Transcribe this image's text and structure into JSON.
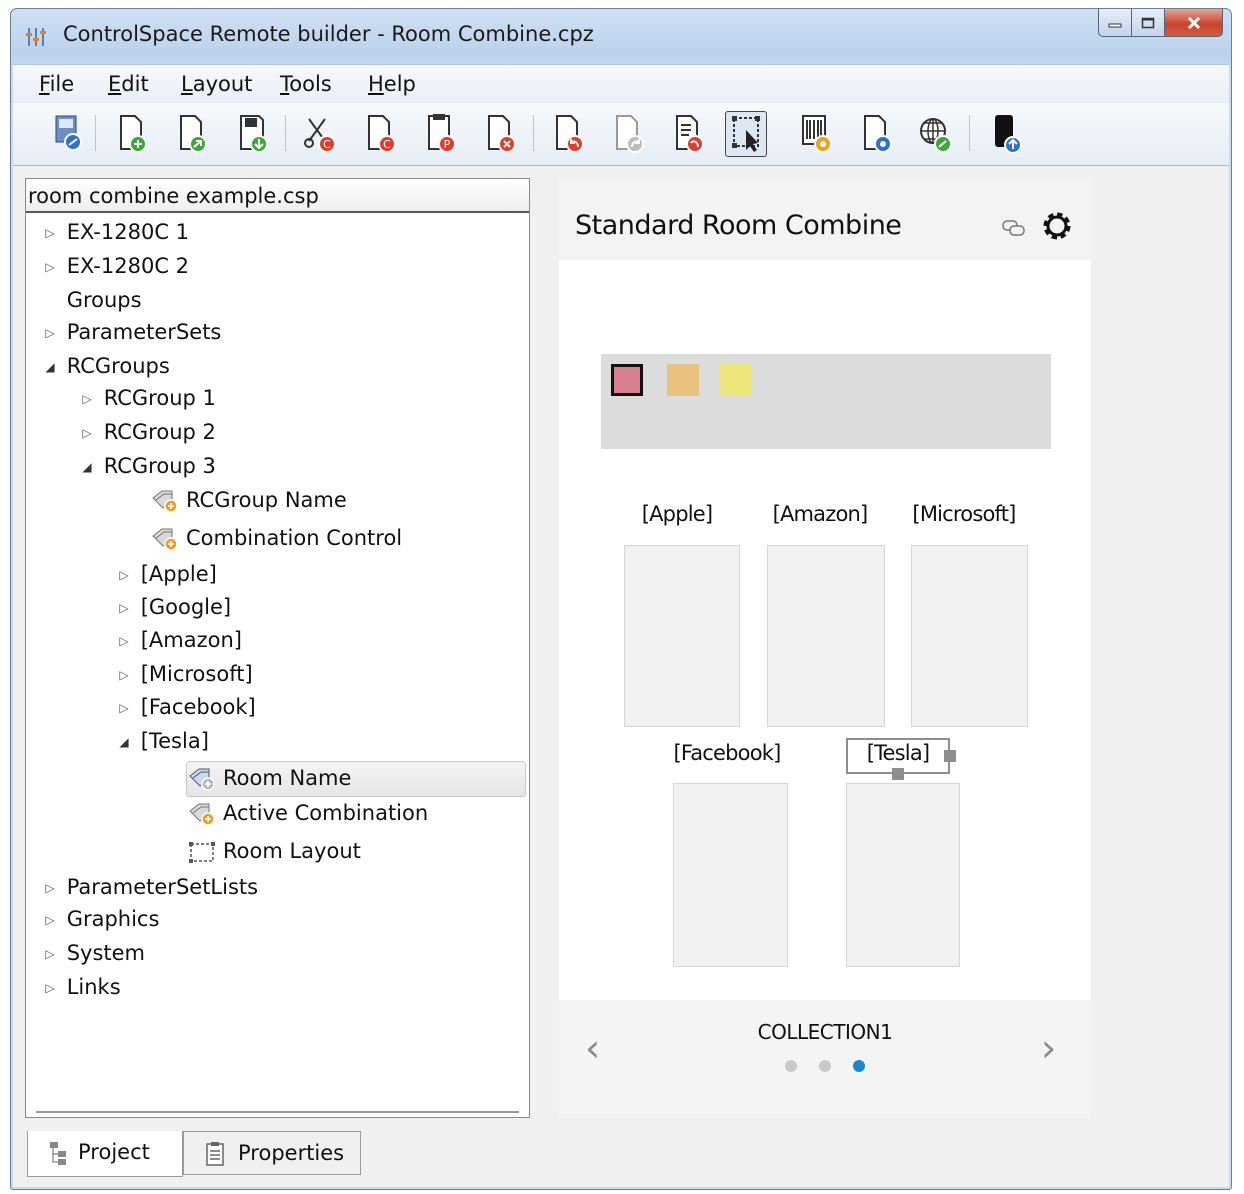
{
  "window": {
    "title": "ControlSpace Remote builder - Room Combine.cpz"
  },
  "menu": [
    {
      "label": "File",
      "u": "F",
      "rest": "ile"
    },
    {
      "label": "Edit",
      "u": "E",
      "rest": "dit"
    },
    {
      "label": "Layout",
      "u": "L",
      "rest": "ayout"
    },
    {
      "label": "Tools",
      "u": "T",
      "rest": "ools"
    },
    {
      "label": "Help",
      "u": "H",
      "rest": "elp"
    }
  ],
  "tree": {
    "header": "room combine example.csp",
    "rows": [
      {
        "label": "EX-1280C 1"
      },
      {
        "label": "EX-1280C 2"
      },
      {
        "label": "Groups"
      },
      {
        "label": "ParameterSets"
      },
      {
        "label": "RCGroups"
      },
      {
        "label": "RCGroup 1"
      },
      {
        "label": "RCGroup 2"
      },
      {
        "label": "RCGroup 3"
      },
      {
        "label": "RCGroup Name"
      },
      {
        "label": "Combination Control"
      },
      {
        "label": "[Apple]"
      },
      {
        "label": "[Google]"
      },
      {
        "label": "[Amazon]"
      },
      {
        "label": "[Microsoft]"
      },
      {
        "label": "[Facebook]"
      },
      {
        "label": "[Tesla]"
      },
      {
        "label": "Room Name"
      },
      {
        "label": "Active Combination"
      },
      {
        "label": "Room Layout"
      },
      {
        "label": "ParameterSetLists"
      },
      {
        "label": "Graphics"
      },
      {
        "label": "System"
      },
      {
        "label": "Links"
      }
    ]
  },
  "tabs": {
    "project": "Project",
    "properties": "Properties"
  },
  "preview": {
    "title": "Standard Room Combine",
    "swatch_colors": [
      "#d9808e",
      "#e8c27e",
      "#ebe57a"
    ],
    "rooms": [
      "[Apple]",
      "[Amazon]",
      "[Microsoft]",
      "[Facebook]",
      "[Tesla]"
    ],
    "collection": "COLLECTION1",
    "page_count": 3,
    "active_page": 3
  }
}
